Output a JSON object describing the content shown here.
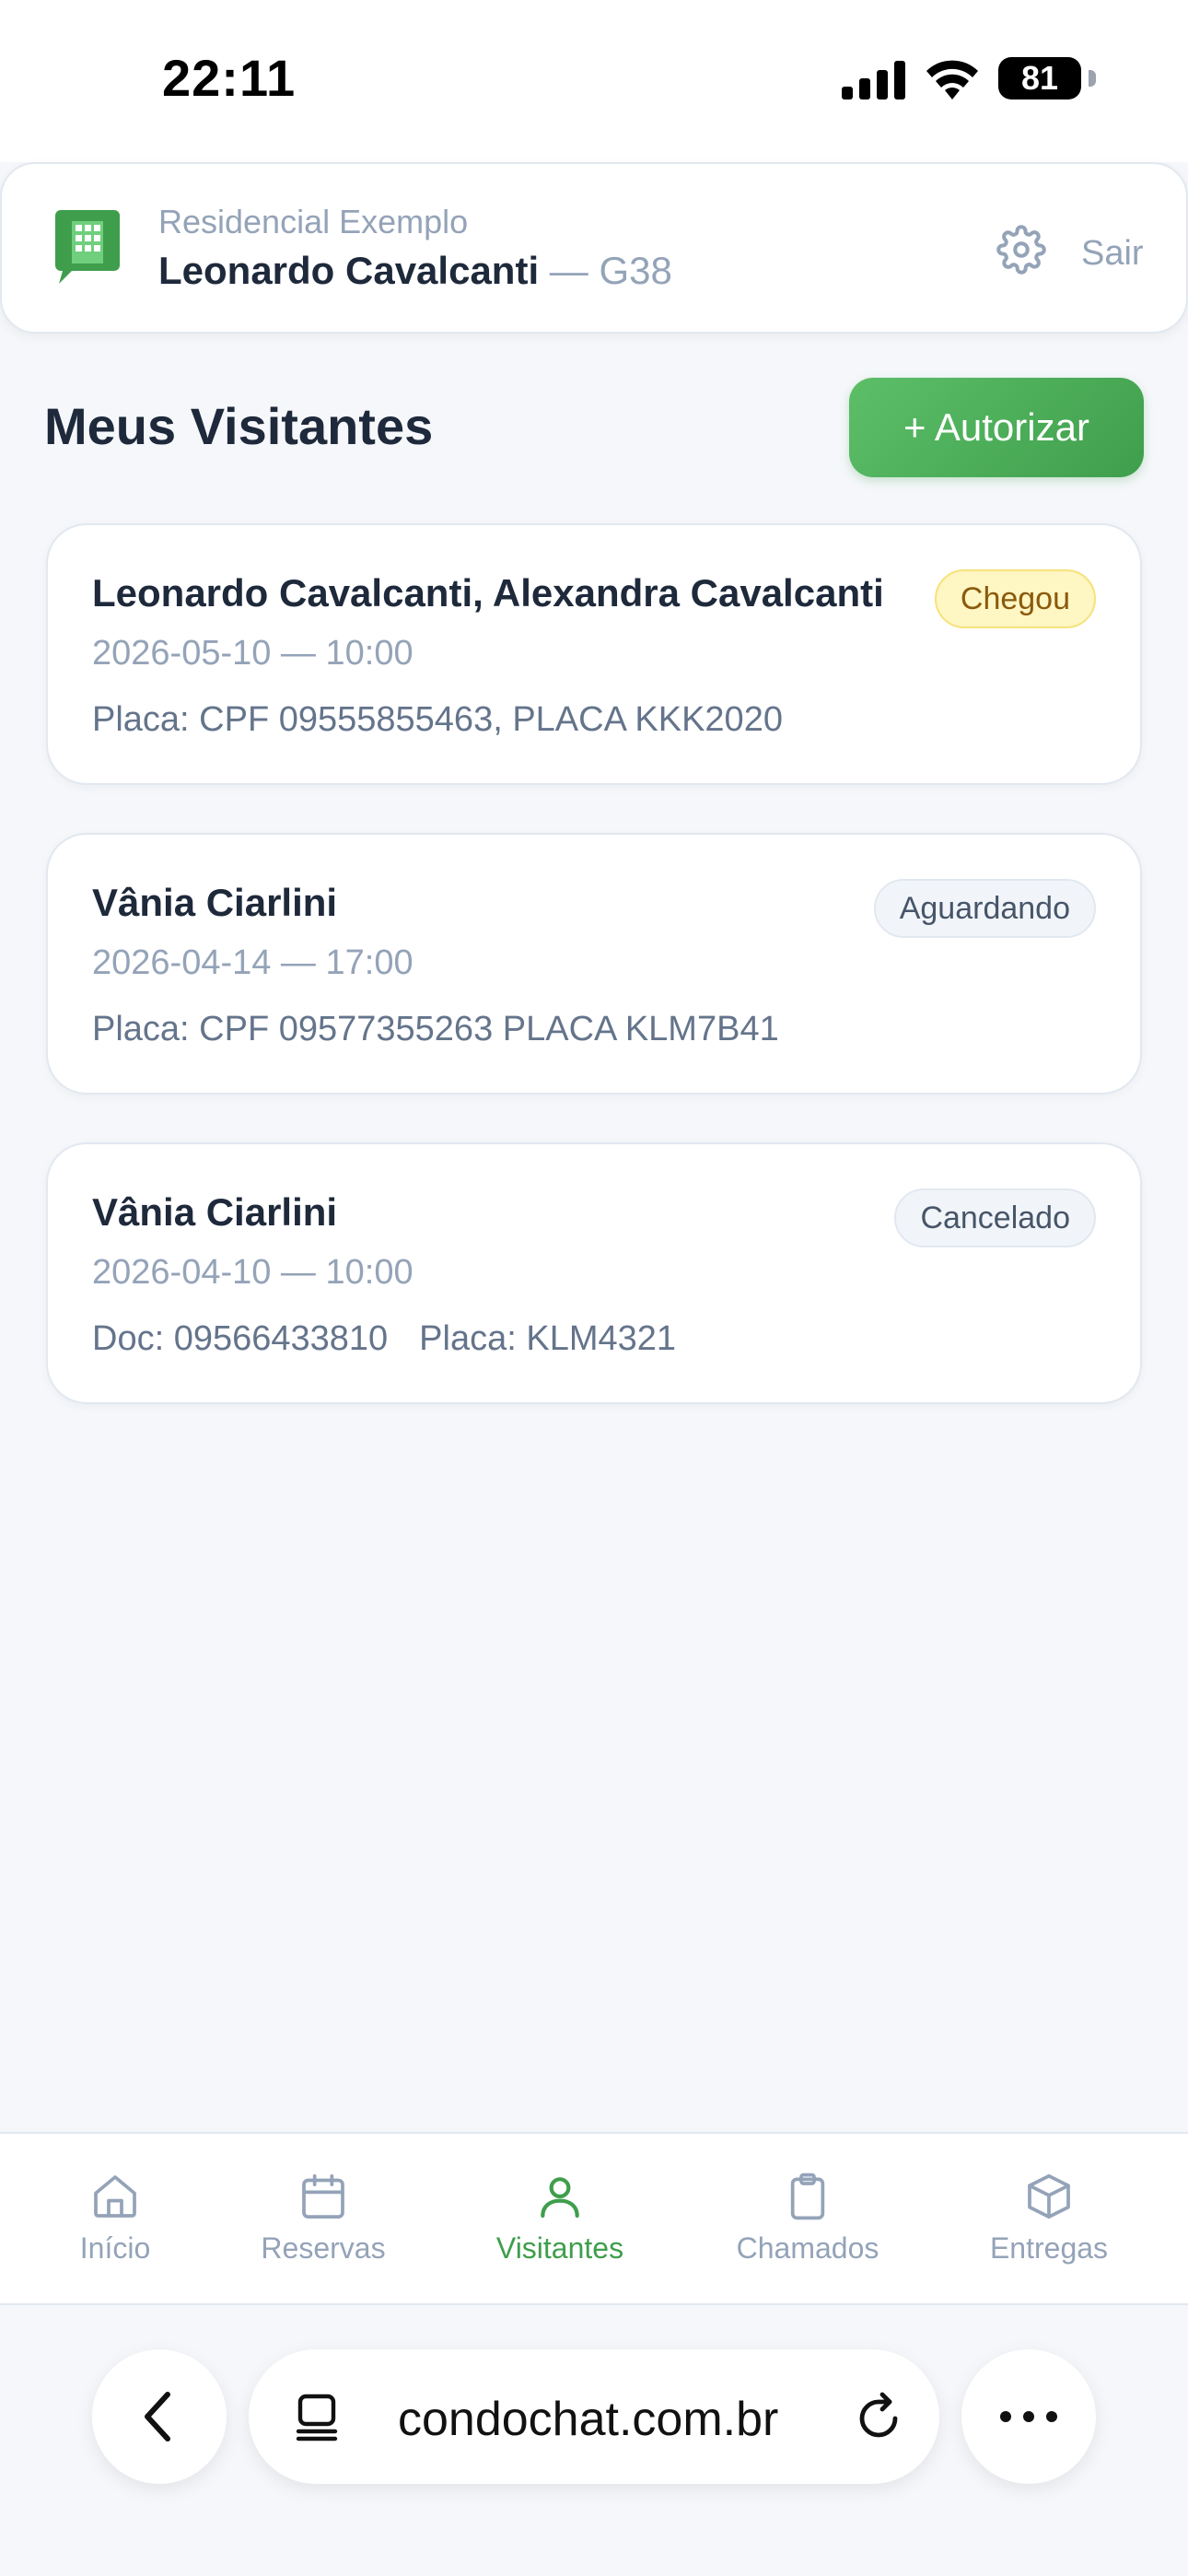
{
  "status_bar": {
    "time": "22:11",
    "battery": "81"
  },
  "header": {
    "condo_name": "Residencial Exemplo",
    "user_name": "Leonardo Cavalcanti",
    "unit_separator": " — ",
    "unit": "G38",
    "logout_label": "Sair"
  },
  "page": {
    "title": "Meus Visitantes",
    "authorize_button": "+ Autorizar"
  },
  "visitors": [
    {
      "name": "Leonardo Cavalcanti, Alexandra Cavalcanti",
      "datetime": "2026-05-10 — 10:00",
      "detail": "Placa: CPF 09555855463, PLACA KKK2020",
      "status": "Chegou"
    },
    {
      "name": "Vânia Ciarlini",
      "datetime": "2026-04-14 — 17:00",
      "detail": "Placa: CPF 09577355263 PLACA KLM7B41",
      "status": "Aguardando"
    },
    {
      "name": "Vânia Ciarlini",
      "datetime": "2026-04-10 — 10:00",
      "doc": "Doc: 09566433810",
      "plate": "Placa: KLM4321",
      "status": "Cancelado"
    }
  ],
  "nav": {
    "items": [
      {
        "label": "Início",
        "icon": "home-icon"
      },
      {
        "label": "Reservas",
        "icon": "calendar-icon"
      },
      {
        "label": "Visitantes",
        "icon": "user-icon",
        "active": true
      },
      {
        "label": "Chamados",
        "icon": "clipboard-icon"
      },
      {
        "label": "Entregas",
        "icon": "package-icon"
      }
    ]
  },
  "browser": {
    "url": "condochat.com.br"
  },
  "colors": {
    "accent": "#3f9e4c",
    "muted": "#94a3b8",
    "arrived_badge": "#fef6c3"
  }
}
